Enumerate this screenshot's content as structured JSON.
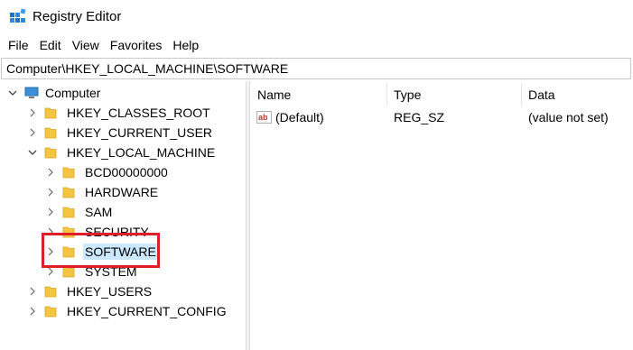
{
  "window": {
    "title": "Registry Editor",
    "app_icon": "registry-icon"
  },
  "menu": [
    "File",
    "Edit",
    "View",
    "Favorites",
    "Help"
  ],
  "address": "Computer\\HKEY_LOCAL_MACHINE\\SOFTWARE",
  "tree": {
    "root": "Computer",
    "items": [
      {
        "label": "HKEY_CLASSES_ROOT"
      },
      {
        "label": "HKEY_CURRENT_USER"
      },
      {
        "label": "HKEY_LOCAL_MACHINE"
      },
      {
        "label": "BCD00000000"
      },
      {
        "label": "HARDWARE"
      },
      {
        "label": "SAM"
      },
      {
        "label": "SECURITY"
      },
      {
        "label": "SOFTWARE"
      },
      {
        "label": "SYSTEM"
      },
      {
        "label": "HKEY_USERS"
      },
      {
        "label": "HKEY_CURRENT_CONFIG"
      }
    ],
    "selected": "SOFTWARE"
  },
  "list": {
    "columns": [
      "Name",
      "Type",
      "Data"
    ],
    "rows": [
      {
        "name": "(Default)",
        "type": "REG_SZ",
        "data": "(value not set)",
        "icon": "string-value-icon"
      }
    ]
  },
  "colors": {
    "selection": "#cce8ff",
    "highlight_border": "#e01e2a",
    "folder": "#f5c542"
  }
}
